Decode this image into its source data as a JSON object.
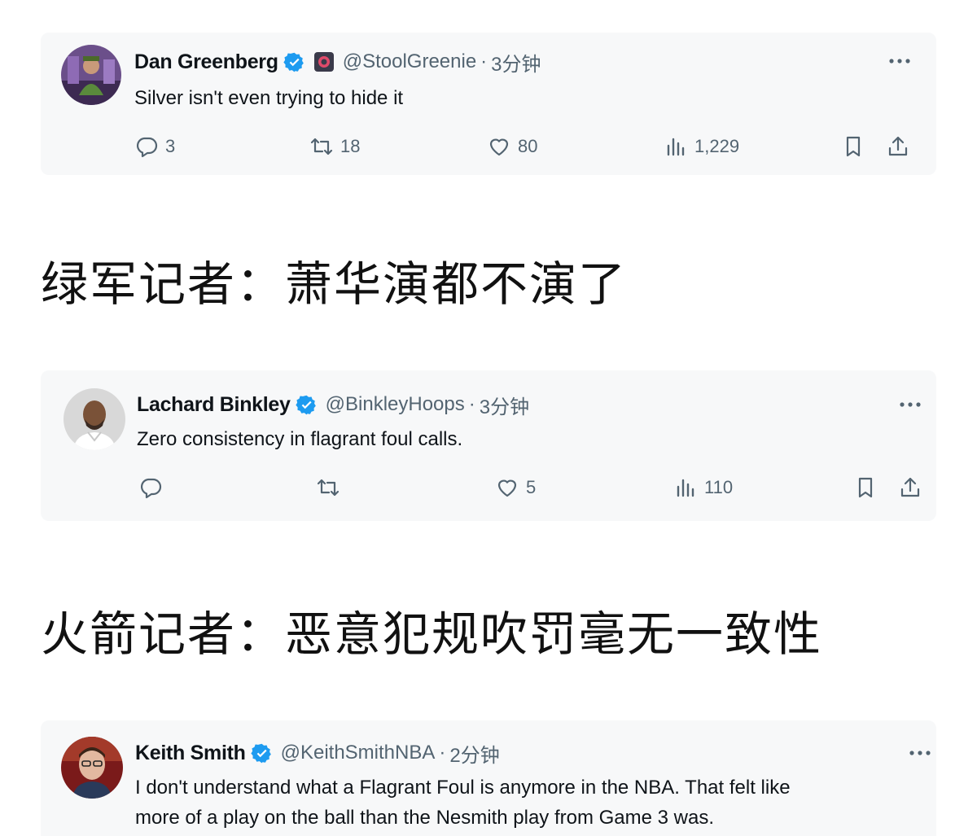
{
  "tweets": [
    {
      "name": "Dan Greenberg",
      "handle": "@StoolGreenie",
      "separator": "·",
      "time": "3分钟",
      "text": [
        "Silver isn't even trying to hide it"
      ],
      "actions": {
        "reply": "3",
        "retweet": "18",
        "like": "80",
        "views": "1,229"
      }
    },
    {
      "name": "Lachard Binkley",
      "handle": "@BinkleyHoops",
      "separator": "·",
      "time": "3分钟",
      "text": [
        "Zero consistency in flagrant foul calls."
      ],
      "actions": {
        "reply": "",
        "retweet": "",
        "like": "5",
        "views": "110"
      }
    },
    {
      "name": "Keith Smith",
      "handle": "@KeithSmithNBA",
      "separator": "·",
      "time": "2分钟",
      "text": [
        "I don't understand what a Flagrant Foul is anymore in the NBA. That felt like",
        "more of a play on the ball than the Nesmith play from Game 3 was."
      ]
    }
  ],
  "captions": [
    "绿军记者：萧华演都不演了",
    "火箭记者：恶意犯规吹罚毫无一致性"
  ],
  "icons": {
    "more": "more-horizontal-icon",
    "reply": "reply-bubble-icon",
    "retweet": "retweet-icon",
    "like": "heart-icon",
    "views": "analytics-bars-icon",
    "bookmark": "bookmark-icon",
    "share": "share-upload-icon",
    "verified": "verified-badge-icon"
  },
  "colors": {
    "verified": "#1d9bf0",
    "secondary_text": "#536471",
    "card_background": "#f7f8f9"
  }
}
